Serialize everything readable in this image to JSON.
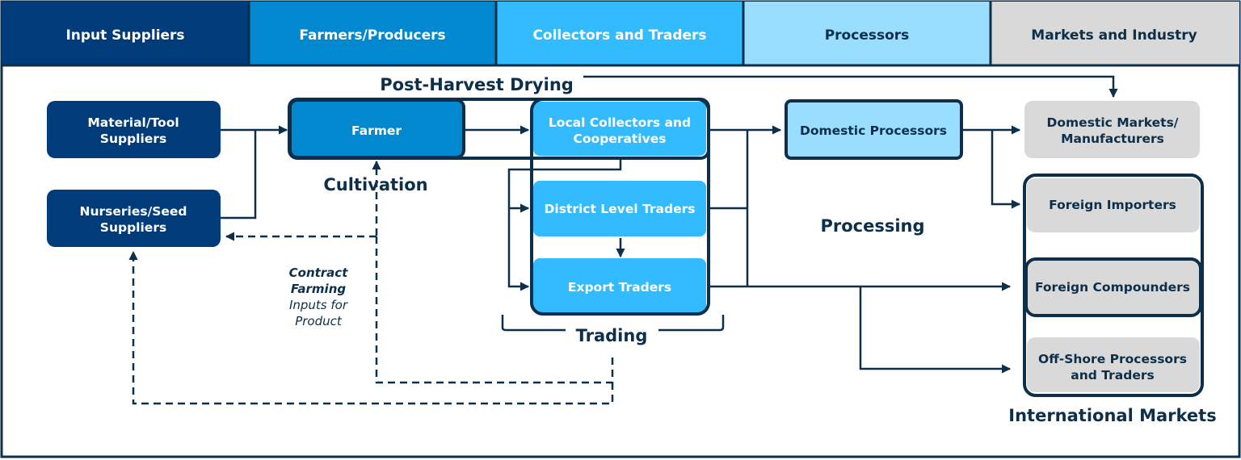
{
  "colors": {
    "input_suppliers": "#003b7a",
    "farmers": "#0288cf",
    "collectors": "#33bbff",
    "processors": "#99ddff",
    "markets": "#d9d9d9",
    "outline": "#0d2f4a"
  },
  "header": {
    "columns": [
      "Input Suppliers",
      "Farmers/Producers",
      "Collectors and Traders",
      "Processors",
      "Markets and Industry"
    ]
  },
  "nodes": {
    "material": [
      "Material/Tool",
      "Suppliers"
    ],
    "nurseries": [
      "Nurseries/Seed",
      "Suppliers"
    ],
    "farmer": "Farmer",
    "local": [
      "Local Collectors and",
      "Cooperatives"
    ],
    "district": "District Level Traders",
    "export": "Export Traders",
    "domestic_processors": "Domestic Processors",
    "domestic_markets": [
      "Domestic Markets/",
      "Manufacturers"
    ],
    "foreign_importers": "Foreign Importers",
    "foreign_compounders": "Foreign Compounders",
    "offshore": [
      "Off-Shore Processors",
      "and Traders"
    ]
  },
  "stages": {
    "post_harvest": "Post-Harvest Drying",
    "cultivation": "Cultivation",
    "trading": "Trading",
    "processing": "Processing",
    "international": "International Markets"
  },
  "contract": {
    "title": [
      "Contract",
      "Farming"
    ],
    "subtitle": [
      "Inputs for",
      "Product"
    ]
  }
}
